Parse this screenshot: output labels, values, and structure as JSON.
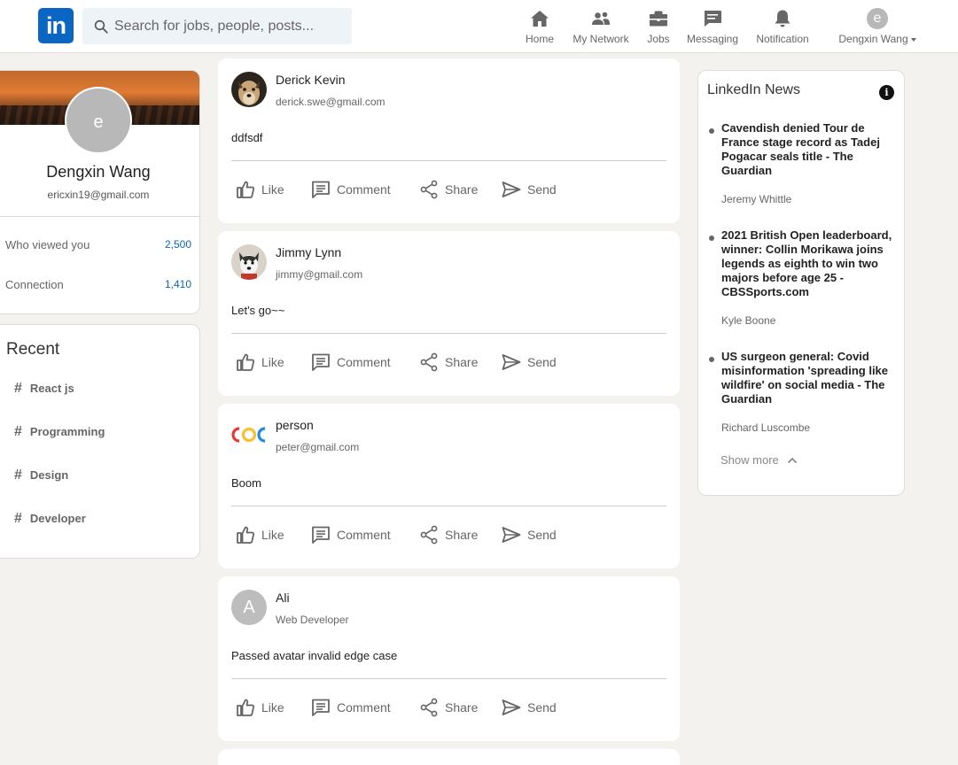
{
  "header": {
    "logo": "in",
    "search_placeholder": "Search for jobs, people, posts...",
    "nav": [
      {
        "label": "Home",
        "icon": "home-icon"
      },
      {
        "label": "My Network",
        "icon": "network-icon"
      },
      {
        "label": "Jobs",
        "icon": "briefcase-icon"
      },
      {
        "label": "Messaging",
        "icon": "message-icon"
      },
      {
        "label": "Notification",
        "icon": "bell-icon"
      }
    ],
    "me": {
      "initial": "e",
      "name": "Dengxin Wang"
    }
  },
  "profile": {
    "initial": "e",
    "name": "Dengxin Wang",
    "email": "ericxin19@gmail.com",
    "stats": [
      {
        "label": "Who viewed you",
        "value": "2,500"
      },
      {
        "label": "Connection",
        "value": "1,410"
      }
    ]
  },
  "recent": {
    "title": "Recent",
    "tags": [
      "React js",
      "Programming",
      "Design",
      "Developer"
    ]
  },
  "actions": {
    "like": "Like",
    "comment": "Comment",
    "share": "Share",
    "send": "Send"
  },
  "posts": [
    {
      "name": "Derick Kevin",
      "sub": "derick.swe@gmail.com",
      "body": "ddfsdf"
    },
    {
      "name": "Jimmy Lynn",
      "sub": "jimmy@gmail.com",
      "body": "Let's go~~"
    },
    {
      "name": "person",
      "sub": "peter@gmail.com",
      "body": "Boom"
    },
    {
      "name": "Ali",
      "sub": "Web Developer",
      "body": "Passed avatar invalid edge case",
      "initial": "A"
    }
  ],
  "news": {
    "title": "LinkedIn News",
    "info_icon": "i",
    "items": [
      {
        "headline": "Cavendish denied Tour de France stage record as Tadej Pogacar seals title - The Guardian",
        "author": "Jeremy Whittle"
      },
      {
        "headline": "2021 British Open leaderboard, winner: Collin Morikawa joins legends as eighth to win two majors before age 25 - CBSSports.com",
        "author": "Kyle Boone"
      },
      {
        "headline": "US surgeon general: Covid misinformation 'spreading like wildfire' on social media - The Guardian",
        "author": "Richard Luscombe"
      }
    ],
    "show_more": "Show more"
  },
  "colors": {
    "brand": "#0a66c2",
    "background": "#f3f2ef"
  }
}
